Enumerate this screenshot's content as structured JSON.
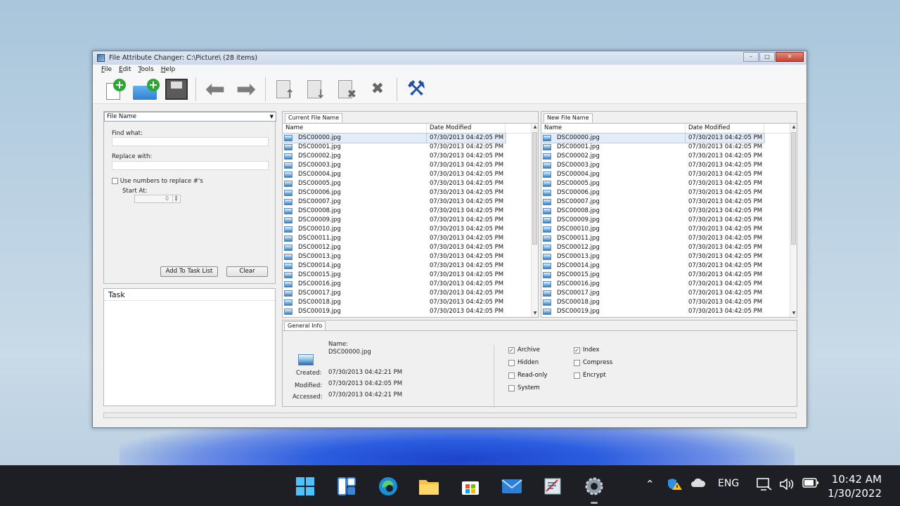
{
  "window": {
    "title": "File Attribute Changer: C:\\Picture\\ (28 items)",
    "controls": {
      "minimize": "–",
      "maximize": "□",
      "close": "✕"
    }
  },
  "menu": [
    "File",
    "Edit",
    "Tools",
    "Help"
  ],
  "toolbar": {
    "icons": [
      "new-file-icon",
      "new-folder-icon",
      "save-icon",
      "back-arrow-icon",
      "forward-arrow-icon",
      "import-icon",
      "export-icon",
      "delete-icon",
      "clear-icon",
      "tools-icon"
    ]
  },
  "rename": {
    "mode": "File Name",
    "find_label": "Find what:",
    "find_value": "",
    "replace_label": "Replace with:",
    "replace_value": "",
    "use_numbers_label": "Use numbers to replace #'s",
    "use_numbers_checked": false,
    "start_at_label": "Start At:",
    "start_at_value": "0",
    "add_button": "Add To Task List",
    "clear_button": "Clear"
  },
  "task": {
    "header": "Task"
  },
  "current_list": {
    "tab": "Current File Name",
    "columns": [
      "Name",
      "Date Modified"
    ],
    "rows": [
      [
        "DSC00000.jpg",
        "07/30/2013 04:42:05 PM"
      ],
      [
        "DSC00001.jpg",
        "07/30/2013 04:42:05 PM"
      ],
      [
        "DSC00002.jpg",
        "07/30/2013 04:42:05 PM"
      ],
      [
        "DSC00003.jpg",
        "07/30/2013 04:42:05 PM"
      ],
      [
        "DSC00004.jpg",
        "07/30/2013 04:42:05 PM"
      ],
      [
        "DSC00005.jpg",
        "07/30/2013 04:42:05 PM"
      ],
      [
        "DSC00006.jpg",
        "07/30/2013 04:42:05 PM"
      ],
      [
        "DSC00007.jpg",
        "07/30/2013 04:42:05 PM"
      ],
      [
        "DSC00008.jpg",
        "07/30/2013 04:42:05 PM"
      ],
      [
        "DSC00009.jpg",
        "07/30/2013 04:42:05 PM"
      ],
      [
        "DSC00010.jpg",
        "07/30/2013 04:42:05 PM"
      ],
      [
        "DSC00011.jpg",
        "07/30/2013 04:42:05 PM"
      ],
      [
        "DSC00012.jpg",
        "07/30/2013 04:42:05 PM"
      ],
      [
        "DSC00013.jpg",
        "07/30/2013 04:42:05 PM"
      ],
      [
        "DSC00014.jpg",
        "07/30/2013 04:42:05 PM"
      ],
      [
        "DSC00015.jpg",
        "07/30/2013 04:42:05 PM"
      ],
      [
        "DSC00016.jpg",
        "07/30/2013 04:42:05 PM"
      ],
      [
        "DSC00017.jpg",
        "07/30/2013 04:42:05 PM"
      ],
      [
        "DSC00018.jpg",
        "07/30/2013 04:42:05 PM"
      ],
      [
        "DSC00019.jpg",
        "07/30/2013 04:42:05 PM"
      ]
    ]
  },
  "new_list": {
    "tab": "New File Name",
    "columns": [
      "Name",
      "Date Modified"
    ],
    "rows": [
      [
        "DSC00000.jpg",
        "07/30/2013 04:42:05 PM"
      ],
      [
        "DSC00001.jpg",
        "07/30/2013 04:42:05 PM"
      ],
      [
        "DSC00002.jpg",
        "07/30/2013 04:42:05 PM"
      ],
      [
        "DSC00003.jpg",
        "07/30/2013 04:42:05 PM"
      ],
      [
        "DSC00004.jpg",
        "07/30/2013 04:42:05 PM"
      ],
      [
        "DSC00005.jpg",
        "07/30/2013 04:42:05 PM"
      ],
      [
        "DSC00006.jpg",
        "07/30/2013 04:42:05 PM"
      ],
      [
        "DSC00007.jpg",
        "07/30/2013 04:42:05 PM"
      ],
      [
        "DSC00008.jpg",
        "07/30/2013 04:42:05 PM"
      ],
      [
        "DSC00009.jpg",
        "07/30/2013 04:42:05 PM"
      ],
      [
        "DSC00010.jpg",
        "07/30/2013 04:42:05 PM"
      ],
      [
        "DSC00011.jpg",
        "07/30/2013 04:42:05 PM"
      ],
      [
        "DSC00012.jpg",
        "07/30/2013 04:42:05 PM"
      ],
      [
        "DSC00013.jpg",
        "07/30/2013 04:42:05 PM"
      ],
      [
        "DSC00014.jpg",
        "07/30/2013 04:42:05 PM"
      ],
      [
        "DSC00015.jpg",
        "07/30/2013 04:42:05 PM"
      ],
      [
        "DSC00016.jpg",
        "07/30/2013 04:42:05 PM"
      ],
      [
        "DSC00017.jpg",
        "07/30/2013 04:42:05 PM"
      ],
      [
        "DSC00018.jpg",
        "07/30/2013 04:42:05 PM"
      ],
      [
        "DSC00019.jpg",
        "07/30/2013 04:42:05 PM"
      ]
    ]
  },
  "general_info": {
    "tab": "General Info",
    "name_label": "Name:",
    "name_value": "DSC00000.jpg",
    "created_label": "Created:",
    "created_value": "07/30/2013 04:42:21 PM",
    "modified_label": "Modified:",
    "modified_value": "07/30/2013 04:42:05 PM",
    "accessed_label": "Accessed:",
    "accessed_value": "07/30/2013 04:42:21 PM",
    "attributes": [
      {
        "label": "Archive",
        "checked": true
      },
      {
        "label": "Hidden",
        "checked": false
      },
      {
        "label": "Read-only",
        "checked": false
      },
      {
        "label": "System",
        "checked": false
      },
      {
        "label": "Index",
        "checked": true
      },
      {
        "label": "Compress",
        "checked": false
      },
      {
        "label": "Encrypt",
        "checked": false
      }
    ]
  },
  "taskbar": {
    "apps": [
      "windows-start-icon",
      "widgets-icon",
      "edge-browser-icon",
      "file-explorer-icon",
      "microsoft-store-icon",
      "mail-icon",
      "app-icon",
      "settings-gear-icon"
    ],
    "language": "ENG",
    "time": "10:42 AM",
    "date": "1/30/2022"
  }
}
